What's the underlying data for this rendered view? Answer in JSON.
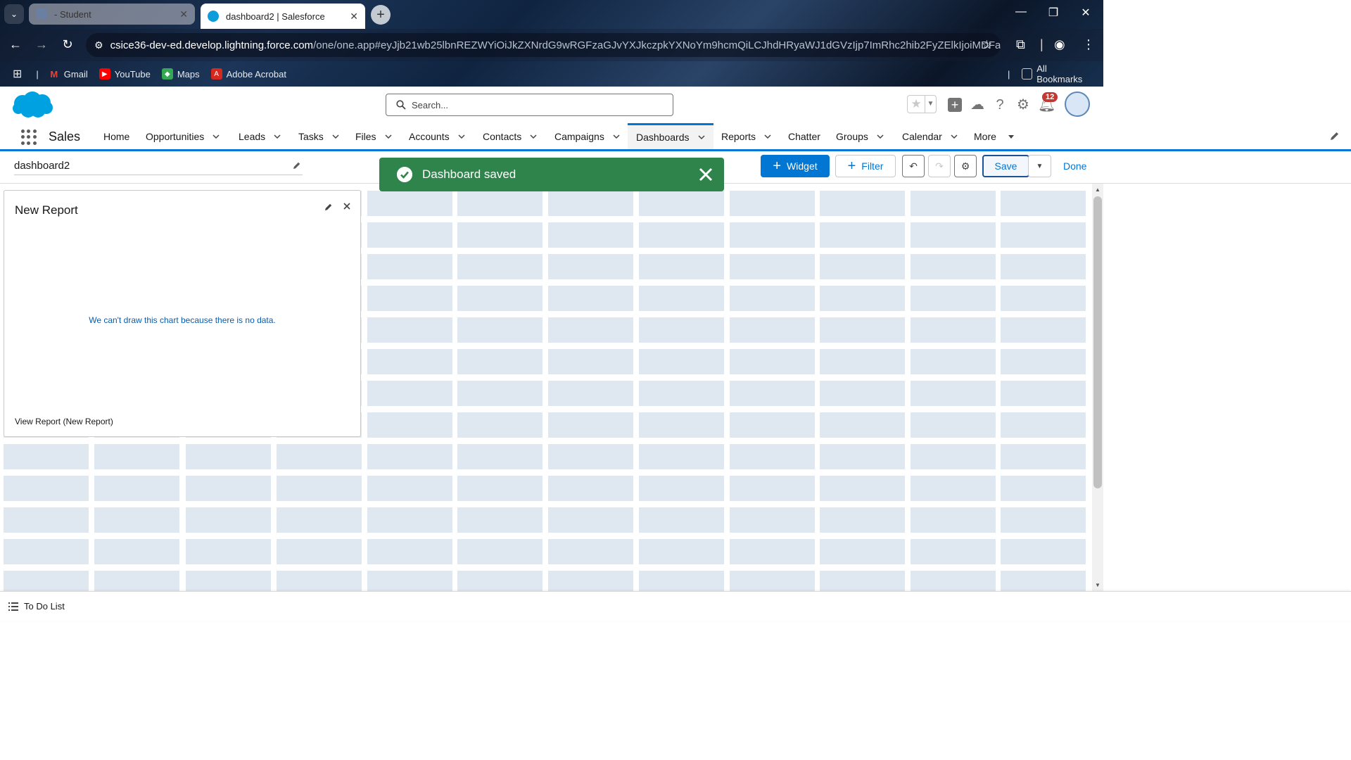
{
  "browser": {
    "tabs": [
      {
        "title": "- Student",
        "active": false
      },
      {
        "title": "dashboard2 | Salesforce",
        "active": true
      }
    ],
    "url_host": "csice36-dev-ed.develop.lightning.force.com",
    "url_path": "/one/one.app#eyJjb21wb25lbnREZWYiOiJkZXNrdG9wRGFzaGJvYXJkczpkYXNoYm9hcmQiLCJhdHRyaWJ1dGVzIjp7ImRhc2hib2FyZElkIjoiMDFaUXkwM...",
    "bookmarks": [
      "Gmail",
      "YouTube",
      "Maps",
      "Adobe Acrobat"
    ],
    "all_bookmarks_label": "All Bookmarks"
  },
  "header": {
    "search_placeholder": "Search...",
    "notification_count": "12"
  },
  "app_nav": {
    "app_name": "Sales",
    "items": [
      {
        "label": "Home",
        "has_menu": false
      },
      {
        "label": "Opportunities",
        "has_menu": true
      },
      {
        "label": "Leads",
        "has_menu": true
      },
      {
        "label": "Tasks",
        "has_menu": true
      },
      {
        "label": "Files",
        "has_menu": true
      },
      {
        "label": "Accounts",
        "has_menu": true
      },
      {
        "label": "Contacts",
        "has_menu": true
      },
      {
        "label": "Campaigns",
        "has_menu": true
      },
      {
        "label": "Dashboards",
        "has_menu": true,
        "active": true
      },
      {
        "label": "Reports",
        "has_menu": true
      },
      {
        "label": "Chatter",
        "has_menu": false
      },
      {
        "label": "Groups",
        "has_menu": true
      },
      {
        "label": "Calendar",
        "has_menu": true
      },
      {
        "label": "More",
        "has_menu": true
      }
    ]
  },
  "builder": {
    "dashboard_name": "dashboard2",
    "widget_label": "Widget",
    "filter_label": "Filter",
    "save_label": "Save",
    "done_label": "Done"
  },
  "toast": {
    "message": "Dashboard saved",
    "color": "#2e844a"
  },
  "widget": {
    "title": "New Report",
    "no_data_message": "We can't draw this chart because there is no data.",
    "view_report_link": "View Report (New Report)"
  },
  "utility_bar": {
    "todo_label": "To Do List"
  },
  "colors": {
    "brand": "#0176d3",
    "grid_cell": "#dfe7f1",
    "toast_success": "#2e844a",
    "badge": "#c23934"
  }
}
